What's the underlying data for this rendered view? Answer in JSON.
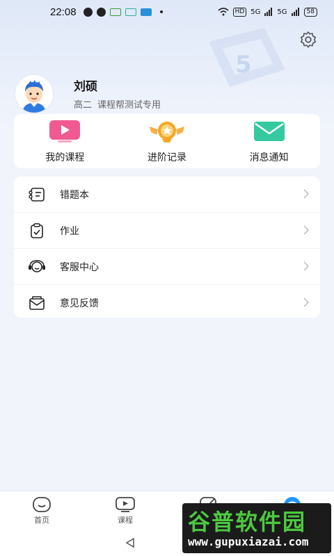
{
  "status_bar": {
    "time": "22:08",
    "hd_badge": "HD",
    "signal1": "5G",
    "signal2": "5G",
    "battery": "58"
  },
  "profile": {
    "name": "刘硕",
    "grade": "高二",
    "subtitle": "课程帮测试专用"
  },
  "quick_actions": [
    {
      "label": "我的课程",
      "icon": "tv-play-icon",
      "color": "#f05a92"
    },
    {
      "label": "进阶记录",
      "icon": "badge-star-icon",
      "color": "#f5a623"
    },
    {
      "label": "消息通知",
      "icon": "mail-icon",
      "color": "#35c9a0"
    }
  ],
  "menu": [
    {
      "label": "错题本",
      "icon": "notebook-icon"
    },
    {
      "label": "作业",
      "icon": "clipboard-icon"
    },
    {
      "label": "客服中心",
      "icon": "headset-icon"
    },
    {
      "label": "意见反馈",
      "icon": "envelope-icon"
    }
  ],
  "tabs": [
    {
      "label": "首页",
      "icon": "home-face-icon"
    },
    {
      "label": "课程",
      "icon": "course-play-icon"
    },
    {
      "label": "",
      "icon": "edit-icon"
    },
    {
      "label": "",
      "icon": "profile-icon",
      "active": true
    }
  ],
  "watermark": {
    "title": "谷普软件园",
    "url": "www.gupuxiazai.com"
  },
  "colors": {
    "accent": "#2196f3",
    "background": "#f1f4fb"
  }
}
